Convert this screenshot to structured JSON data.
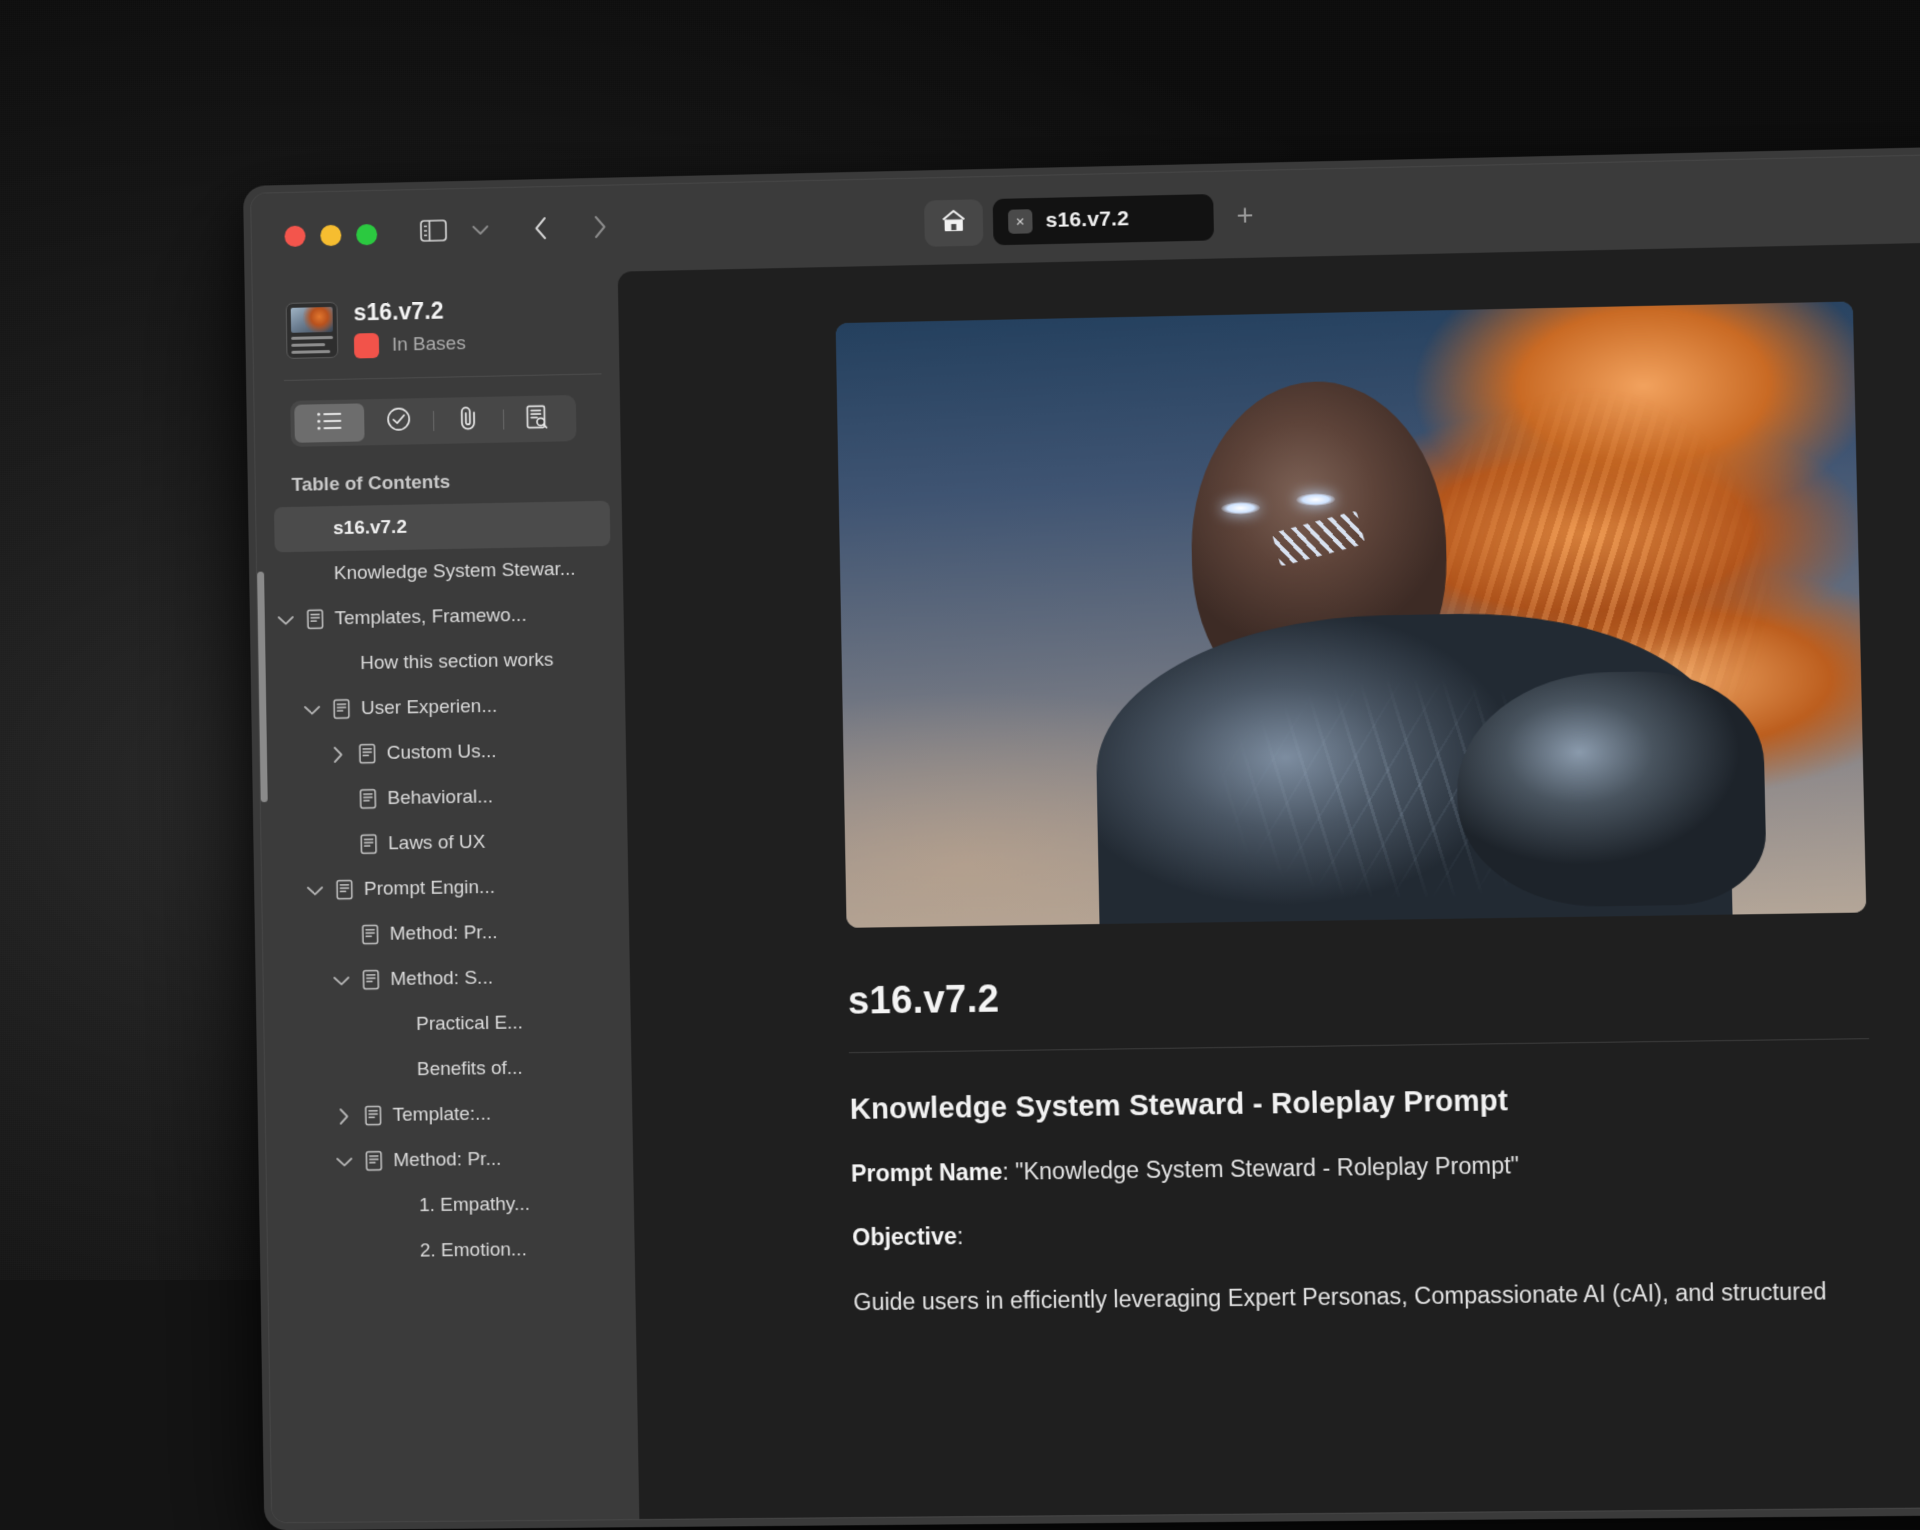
{
  "window": {
    "traffic_lights": [
      "close",
      "minimize",
      "zoom"
    ],
    "colors": {
      "close": "#f3554c",
      "minimize": "#f6bd30",
      "zoom": "#2bc940",
      "status_dot": "#f2534a",
      "window_chrome": "#3b3b3b",
      "content_bg": "#1f1f1f",
      "tab_active_bg": "#121212"
    }
  },
  "toolbar": {
    "sidebar_toggle": "sidebar-toggle-icon",
    "sidebar_chevron": "chevron-down-icon",
    "back_label": "‹",
    "forward_label": "›"
  },
  "tabs": {
    "home_icon": "home-icon",
    "active": {
      "label": "s16.v7.2",
      "close_label": "×"
    },
    "new_tab_label": "+"
  },
  "sidebar": {
    "doc_title": "s16.v7.2",
    "status_text": "In Bases",
    "segments": [
      {
        "name": "outline",
        "icon": "list-icon",
        "active": true
      },
      {
        "name": "tasks",
        "icon": "check-circle-icon",
        "active": false
      },
      {
        "name": "attachments",
        "icon": "paperclip-icon",
        "active": false
      },
      {
        "name": "search-document",
        "icon": "document-search-icon",
        "active": false
      }
    ],
    "toc_header": "Table of Contents",
    "toc": [
      {
        "label": "s16.v7.2",
        "indent": 0,
        "chevron": "none",
        "doc_icon": false,
        "selected": true
      },
      {
        "label": "Knowledge System Stewar...",
        "indent": 0,
        "chevron": "none",
        "doc_icon": false,
        "selected": false
      },
      {
        "label": "Templates, Framewo...",
        "indent": 0,
        "chevron": "down",
        "doc_icon": true,
        "selected": false
      },
      {
        "label": "How this section works",
        "indent": 1,
        "chevron": "none",
        "doc_icon": false,
        "selected": false
      },
      {
        "label": "User Experien...",
        "indent": 1,
        "chevron": "down",
        "doc_icon": true,
        "selected": false
      },
      {
        "label": "Custom Us...",
        "indent": 2,
        "chevron": "right",
        "doc_icon": true,
        "selected": false
      },
      {
        "label": "Behavioral...",
        "indent": 2,
        "chevron": "none",
        "doc_icon": true,
        "selected": false
      },
      {
        "label": "Laws of UX",
        "indent": 2,
        "chevron": "none",
        "doc_icon": true,
        "selected": false
      },
      {
        "label": "Prompt Engin...",
        "indent": 1,
        "chevron": "down",
        "doc_icon": true,
        "selected": false
      },
      {
        "label": "Method: Pr...",
        "indent": 2,
        "chevron": "none",
        "doc_icon": true,
        "selected": false
      },
      {
        "label": "Method: S...",
        "indent": 2,
        "chevron": "down",
        "doc_icon": true,
        "selected": false
      },
      {
        "label": "Practical E...",
        "indent": 3,
        "chevron": "none",
        "doc_icon": false,
        "selected": false
      },
      {
        "label": "Benefits of...",
        "indent": 3,
        "chevron": "none",
        "doc_icon": false,
        "selected": false
      },
      {
        "label": "Template:...",
        "indent": 2,
        "chevron": "right",
        "doc_icon": true,
        "selected": false
      },
      {
        "label": "Method: Pr...",
        "indent": 2,
        "chevron": "down",
        "doc_icon": true,
        "selected": false
      },
      {
        "label": "1. Empathy...",
        "indent": 3,
        "chevron": "none",
        "doc_icon": false,
        "selected": false
      },
      {
        "label": "2. Emotion...",
        "indent": 3,
        "chevron": "none",
        "doc_icon": false,
        "selected": false
      }
    ]
  },
  "content": {
    "hero_alt": "Armored warrior with flowing orange hair and glowing eyes",
    "h1": "s16.v7.2",
    "h2": "Knowledge System Steward - Roleplay Prompt",
    "paragraphs": [
      {
        "label": "Prompt Name",
        "text": ": \"Knowledge System Steward - Roleplay Prompt\""
      },
      {
        "label": "Objective",
        "text": ":"
      }
    ],
    "body_line": "Guide users in efficiently leveraging Expert Personas, Compassionate AI (cAI), and structured"
  }
}
